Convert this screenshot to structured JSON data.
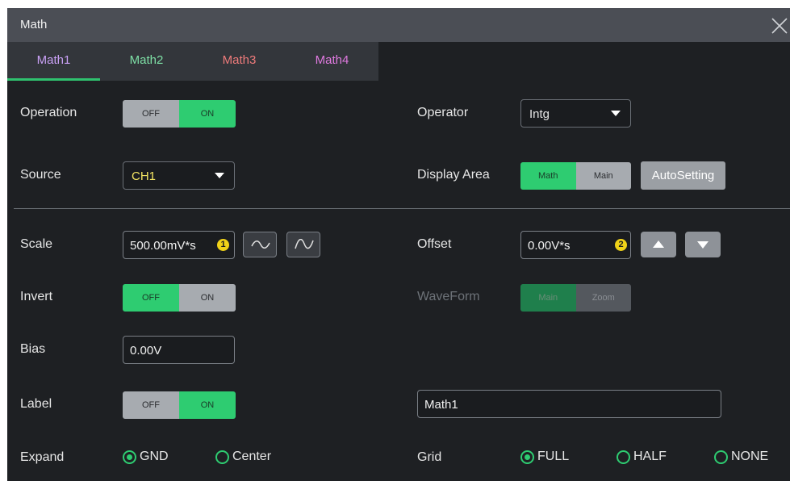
{
  "window": {
    "title": "Math"
  },
  "tabs": [
    {
      "label": "Math1",
      "color": "#c9a0f5",
      "active": true
    },
    {
      "label": "Math2",
      "color": "#7ee0a6",
      "active": false
    },
    {
      "label": "Math3",
      "color": "#ef7b7b",
      "active": false
    },
    {
      "label": "Math4",
      "color": "#e07ae0",
      "active": false
    }
  ],
  "operation": {
    "label": "Operation",
    "off": "OFF",
    "on": "ON",
    "state": "on"
  },
  "operator": {
    "label": "Operator",
    "value": "Intg"
  },
  "source": {
    "label": "Source",
    "value": "CH1",
    "value_color": "#f5e663"
  },
  "display_area": {
    "label": "Display Area",
    "math": "Math",
    "main": "Main",
    "selected": "math",
    "autosetting": "AutoSetting"
  },
  "scale": {
    "label": "Scale",
    "value": "500.00mV*s",
    "badge": "1"
  },
  "offset": {
    "label": "Offset",
    "value": "0.00V*s",
    "badge": "2"
  },
  "invert": {
    "label": "Invert",
    "off": "OFF",
    "on": "ON",
    "state": "off"
  },
  "waveform": {
    "label": "WaveForm",
    "main": "Main",
    "zoom": "Zoom",
    "enabled": false
  },
  "bias": {
    "label": "Bias",
    "value": "0.00V"
  },
  "label_row": {
    "label": "Label",
    "off": "OFF",
    "on": "ON",
    "state": "on",
    "text_value": "Math1"
  },
  "expand": {
    "label": "Expand",
    "options": [
      "GND",
      "Center"
    ],
    "selected": "GND"
  },
  "grid": {
    "label": "Grid",
    "options": [
      "FULL",
      "HALF",
      "NONE"
    ],
    "selected": "FULL"
  },
  "colors": {
    "accent": "#2ecc71",
    "badge": "#f0d218"
  }
}
